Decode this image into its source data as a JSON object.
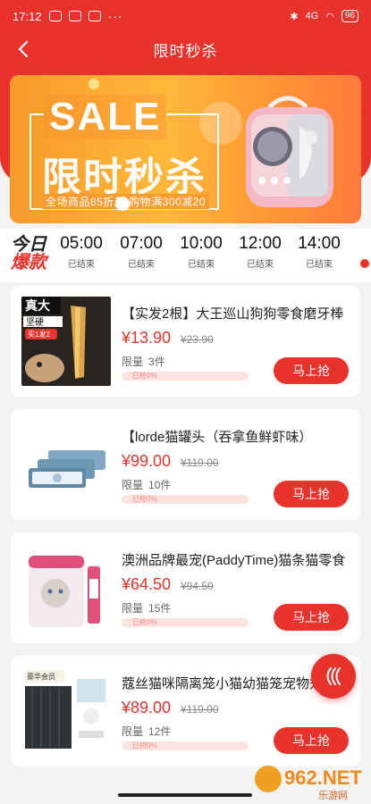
{
  "status_bar": {
    "time": "17:12",
    "dots": "···",
    "signal": "4G",
    "battery": "96"
  },
  "nav": {
    "title": "限时秒杀"
  },
  "banner": {
    "headline": "SALE",
    "title": "限时秒杀",
    "subtitle": "全场商品85折起  购物满300减20"
  },
  "timeline": {
    "today_line1": "今日",
    "today_line2": "爆款",
    "slots": [
      {
        "time": "05:00",
        "state": "已结束"
      },
      {
        "time": "07:00",
        "state": "已结束"
      },
      {
        "time": "10:00",
        "state": "已结束"
      },
      {
        "time": "12:00",
        "state": "已结束"
      },
      {
        "time": "14:00",
        "state": "已结束"
      }
    ]
  },
  "products": [
    {
      "name": "【实发2根】大王巡山狗狗零食磨牙棒",
      "price": "¥13.90",
      "original_price": "¥23.90",
      "limit_label": "限量",
      "limit_value": "3件",
      "progress_text": "已抢0%",
      "progress_fraction": 0.0,
      "buy_label": "马上抢",
      "thumb_badge_1": "真大",
      "thumb_badge_2": "坚硬",
      "thumb_badge_3": "买1发2"
    },
    {
      "name": "【lorde猫罐头（吞拿鱼鲜虾味）",
      "price": "¥99.00",
      "original_price": "¥119.00",
      "limit_label": "限量",
      "limit_value": "10件",
      "progress_text": "已抢0%",
      "progress_fraction": 0.0,
      "buy_label": "马上抢"
    },
    {
      "name": "澳洲品牌最宠(PaddyTime)猫条猫零食",
      "price": "¥64.50",
      "original_price": "¥94.50",
      "limit_label": "限量",
      "limit_value": "15件",
      "progress_text": "已抢0%",
      "progress_fraction": 0.0,
      "buy_label": "马上抢"
    },
    {
      "name": "蔻丝猫咪隔离笼小猫幼猫笼宠物笼",
      "price": "¥89.00",
      "original_price": "¥119.00",
      "limit_label": "限量",
      "limit_value": "12件",
      "progress_text": "已抢0%",
      "progress_fraction": 0.0,
      "buy_label": "马上抢",
      "thumb_badge_1": "豪华会员"
    }
  ],
  "watermark": {
    "brand": "962.NET",
    "sub": "乐游网"
  },
  "colors": {
    "accent": "#e8332c",
    "banner_orange": "#f79a2a"
  },
  "icons": {
    "back": "chevron-left-icon",
    "float": "double-chevron-left-icon"
  }
}
